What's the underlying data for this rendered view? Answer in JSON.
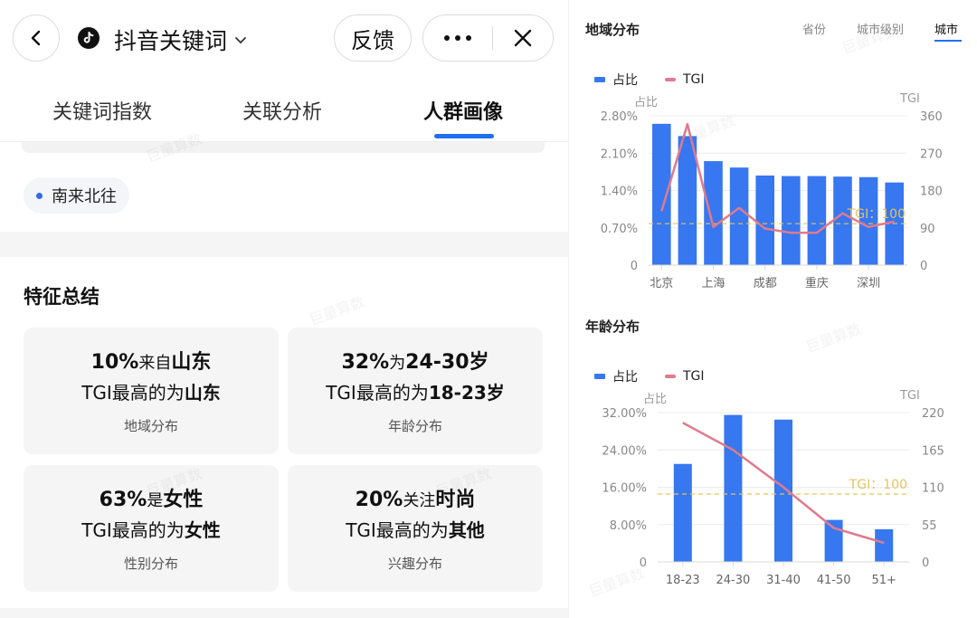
{
  "header": {
    "title": "抖音关键词",
    "feedback_label": "反馈"
  },
  "tabs": [
    {
      "label": "关键词指数"
    },
    {
      "label": "关联分析"
    },
    {
      "label": "人群画像"
    }
  ],
  "keyword_tag": "南来北往",
  "features": {
    "title": "特征总结",
    "cards": [
      {
        "pct": "10%",
        "pct_suffix": "来自",
        "value": "山东",
        "tgi_prefix": "TGI最高的为",
        "tgi_value": "山东",
        "category": "地域分布"
      },
      {
        "pct": "32%",
        "pct_suffix": "为",
        "value": "24-30岁",
        "tgi_prefix": "TGI最高的为",
        "tgi_value": "18-23岁",
        "category": "年龄分布"
      },
      {
        "pct": "63%",
        "pct_suffix": "是",
        "value": "女性",
        "tgi_prefix": "TGI最高的为",
        "tgi_value": "女性",
        "category": "性别分布"
      },
      {
        "pct": "20%",
        "pct_suffix": "关注",
        "value": "时尚",
        "tgi_prefix": "TGI最高的为",
        "tgi_value": "其他",
        "category": "兴趣分布"
      }
    ]
  },
  "region": {
    "title": "地域分布",
    "segments": [
      "省份",
      "城市级别",
      "城市"
    ],
    "active_segment": "城市"
  },
  "age": {
    "title": "年龄分布"
  },
  "legend": {
    "share": "占比",
    "tgi": "TGI"
  },
  "colors": {
    "bar": "#3777f0",
    "tgi_line": "#e07a8c",
    "baseline": "#e6c35c",
    "accent": "#1f6ff0"
  },
  "watermark_text": "巨量算数",
  "chart_data": [
    {
      "type": "bar",
      "title": "地域分布",
      "left_axis_label": "占比",
      "right_axis_label": "TGI",
      "categories": [
        "北京",
        "",
        "上海",
        "",
        "成都",
        "",
        "重庆",
        "",
        "深圳",
        ""
      ],
      "x_tick_labels": [
        "北京",
        "上海",
        "成都",
        "重庆",
        "深圳"
      ],
      "series": [
        {
          "name": "占比",
          "axis": "left",
          "values": [
            2.65,
            2.42,
            1.95,
            1.83,
            1.68,
            1.67,
            1.67,
            1.66,
            1.65,
            1.55
          ]
        },
        {
          "name": "TGI",
          "axis": "right",
          "type": "line",
          "values": [
            130,
            340,
            92,
            138,
            88,
            78,
            78,
            125,
            92,
            105
          ]
        }
      ],
      "left_ticks": [
        "0",
        "0.70%",
        "1.40%",
        "2.10%",
        "2.80%"
      ],
      "right_ticks": [
        "0",
        "90",
        "180",
        "270",
        "360"
      ],
      "ylim_left": [
        0,
        2.8
      ],
      "ylim_right": [
        0,
        360
      ],
      "reference_line": {
        "label": "TGI：100",
        "value": 100
      }
    },
    {
      "type": "bar",
      "title": "年龄分布",
      "left_axis_label": "占比",
      "right_axis_label": "TGI",
      "categories": [
        "18-23",
        "24-30",
        "31-40",
        "41-50",
        "51+"
      ],
      "x_tick_labels": [
        "18-23",
        "24-30",
        "31-40",
        "41-50",
        "51+"
      ],
      "series": [
        {
          "name": "占比",
          "axis": "left",
          "values": [
            21,
            31.5,
            30.5,
            9,
            7
          ]
        },
        {
          "name": "TGI",
          "axis": "right",
          "type": "line",
          "values": [
            205,
            165,
            110,
            50,
            28
          ]
        }
      ],
      "left_ticks": [
        "0",
        "8.00%",
        "16.00%",
        "24.00%",
        "32.00%"
      ],
      "right_ticks": [
        "0",
        "55",
        "110",
        "165",
        "220"
      ],
      "ylim_left": [
        0,
        32
      ],
      "ylim_right": [
        0,
        220
      ],
      "reference_line": {
        "label": "TGI：100",
        "value": 100
      }
    }
  ]
}
